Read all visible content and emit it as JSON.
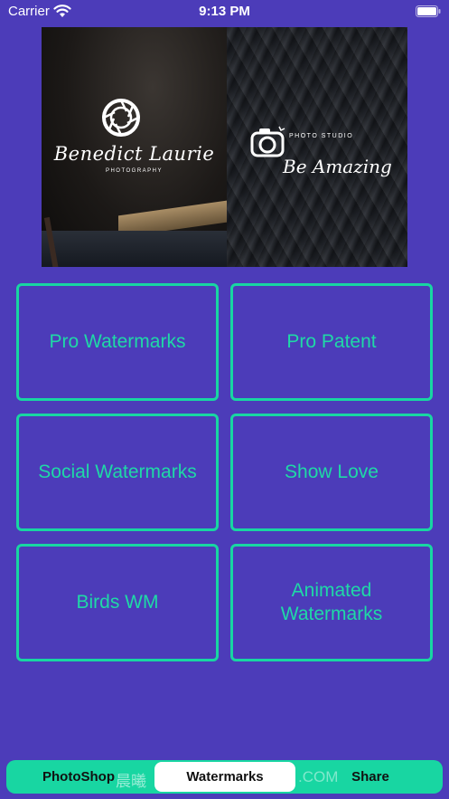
{
  "status_bar": {
    "carrier": "Carrier",
    "time": "9:13 PM"
  },
  "banner": {
    "left_logo_name": "Benedict Laurie",
    "left_logo_sub": "PHOTOGRAPHY",
    "right_logo_sub": "PHOTO STUDIO",
    "right_logo_name": "Be Amazing"
  },
  "grid": {
    "pro_watermarks": "Pro Watermarks",
    "pro_patent": "Pro Patent",
    "social_watermarks": "Social Watermarks",
    "show_love": "Show Love",
    "birds_wm": "Birds WM",
    "animated_watermarks": "Animated Watermarks"
  },
  "tabs": {
    "photoshop": "PhotoShop",
    "watermarks": "Watermarks",
    "share": "Share",
    "active": "Watermarks"
  },
  "overlay_watermark": {
    "left": "晨曦",
    "right": ".COM"
  },
  "colors": {
    "background": "#4c3cb9",
    "accent": "#18d6a2",
    "accent_text": "#1fd9a6"
  },
  "icons": [
    "wifi-icon",
    "battery-icon",
    "aperture-icon",
    "camera-icon"
  ]
}
